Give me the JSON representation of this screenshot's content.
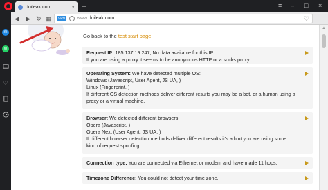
{
  "browser": {
    "tab_title": "doileak.com",
    "tab_close": "×",
    "new_tab": "+",
    "window_controls": {
      "menu": "≡",
      "minimize": "–",
      "maximize": "□",
      "close": "×"
    },
    "url_protocol": "www.",
    "url_host": "doileak.com",
    "vpn_label": "VPN"
  },
  "page": {
    "goback_prefix": "Go back to the ",
    "goback_link": "test start page",
    "goback_suffix": ".",
    "cards": {
      "ip": {
        "label": "Request IP:",
        "line1": " 185.137.19.247, No data available for this IP.",
        "line2": "If you are using a proxy it seems to be anonymous HTTP or a socks proxy."
      },
      "os": {
        "label": "Operating System:",
        "line1": " We have detected multiple OS:",
        "line2": "Windows (Javascript, User Agent, JS UA, )",
        "line3": "Linux (Fingerprint, )",
        "line4": "If different OS detection methods deliver different results you may be a bot, or a human using a",
        "line5": "proxy or a virtual machine."
      },
      "browser": {
        "label": "Browser:",
        "line1": " We detected different browsers:",
        "line2": "Opera (Javascript, )",
        "line3": "Opera Next (User Agent, JS UA, )",
        "line4": "If different browser detection methods deliver different results it's a hint you are using some",
        "line5": "kind of request spoofing."
      },
      "connection": {
        "label": "Connection type:",
        "line1": " You are connected via Ethernet or modem and have made 11 hops."
      },
      "timezone": {
        "label": "Timezone Difference:",
        "line1": " You could not detect your time zone."
      }
    }
  },
  "colors": {
    "accent": "#c89a1c",
    "link": "#d68a00",
    "opera_red": "#ff1b2d",
    "card_bg": "#f4f4f4"
  },
  "icons": {
    "sidebar": [
      "messenger-icon",
      "whatsapp-icon",
      "history-icon",
      "heart-icon",
      "tabs-icon",
      "clock-icon"
    ],
    "address": [
      "back-icon",
      "forward-icon",
      "reload-icon",
      "speed-dial-icon",
      "heart-icon"
    ]
  }
}
